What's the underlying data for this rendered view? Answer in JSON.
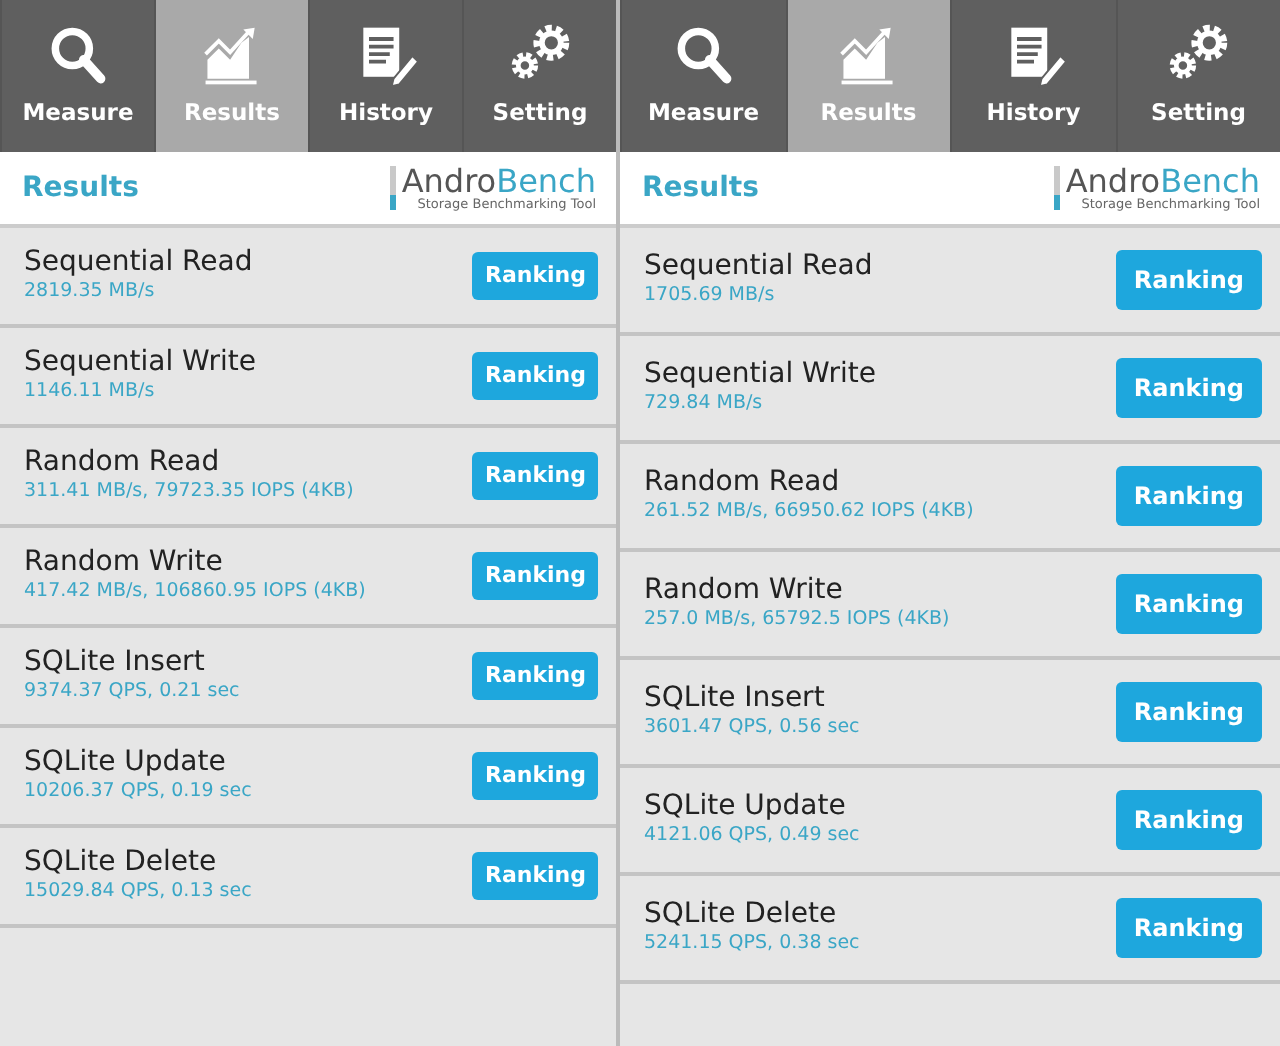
{
  "screens": [
    {
      "tabs": [
        {
          "label": "Measure",
          "selected": false
        },
        {
          "label": "Results",
          "selected": true
        },
        {
          "label": "History",
          "selected": false
        },
        {
          "label": "Setting",
          "selected": false
        }
      ],
      "header": {
        "title": "Results",
        "logo": {
          "part_1": "Andro",
          "part_2": "Bench",
          "tagline": "Storage Benchmarking Tool"
        }
      },
      "results": [
        {
          "name": "Sequential Read",
          "value": "2819.35 MB/s",
          "button": "Ranking"
        },
        {
          "name": "Sequential Write",
          "value": "1146.11 MB/s",
          "button": "Ranking"
        },
        {
          "name": "Random Read",
          "value": "311.41 MB/s, 79723.35 IOPS (4KB)",
          "button": "Ranking"
        },
        {
          "name": "Random Write",
          "value": "417.42 MB/s, 106860.95 IOPS (4KB)",
          "button": "Ranking"
        },
        {
          "name": "SQLite Insert",
          "value": "9374.37 QPS, 0.21 sec",
          "button": "Ranking"
        },
        {
          "name": "SQLite Update",
          "value": "10206.37 QPS, 0.19 sec",
          "button": "Ranking"
        },
        {
          "name": "SQLite Delete",
          "value": "15029.84 QPS, 0.13 sec",
          "button": "Ranking"
        }
      ]
    },
    {
      "tabs": [
        {
          "label": "Measure",
          "selected": false
        },
        {
          "label": "Results",
          "selected": true
        },
        {
          "label": "History",
          "selected": false
        },
        {
          "label": "Setting",
          "selected": false
        }
      ],
      "header": {
        "title": "Results",
        "logo": {
          "part_1": "Andro",
          "part_2": "Bench",
          "tagline": "Storage Benchmarking Tool"
        }
      },
      "results": [
        {
          "name": "Sequential Read",
          "value": "1705.69 MB/s",
          "button": "Ranking"
        },
        {
          "name": "Sequential Write",
          "value": "729.84 MB/s",
          "button": "Ranking"
        },
        {
          "name": "Random Read",
          "value": "261.52 MB/s, 66950.62 IOPS (4KB)",
          "button": "Ranking"
        },
        {
          "name": "Random Write",
          "value": "257.0 MB/s, 65792.5 IOPS (4KB)",
          "button": "Ranking"
        },
        {
          "name": "SQLite Insert",
          "value": "3601.47 QPS, 0.56 sec",
          "button": "Ranking"
        },
        {
          "name": "SQLite Update",
          "value": "4121.06 QPS, 0.49 sec",
          "button": "Ranking"
        },
        {
          "name": "SQLite Delete",
          "value": "5241.15 QPS, 0.38 sec",
          "button": "Ranking"
        }
      ]
    }
  ]
}
